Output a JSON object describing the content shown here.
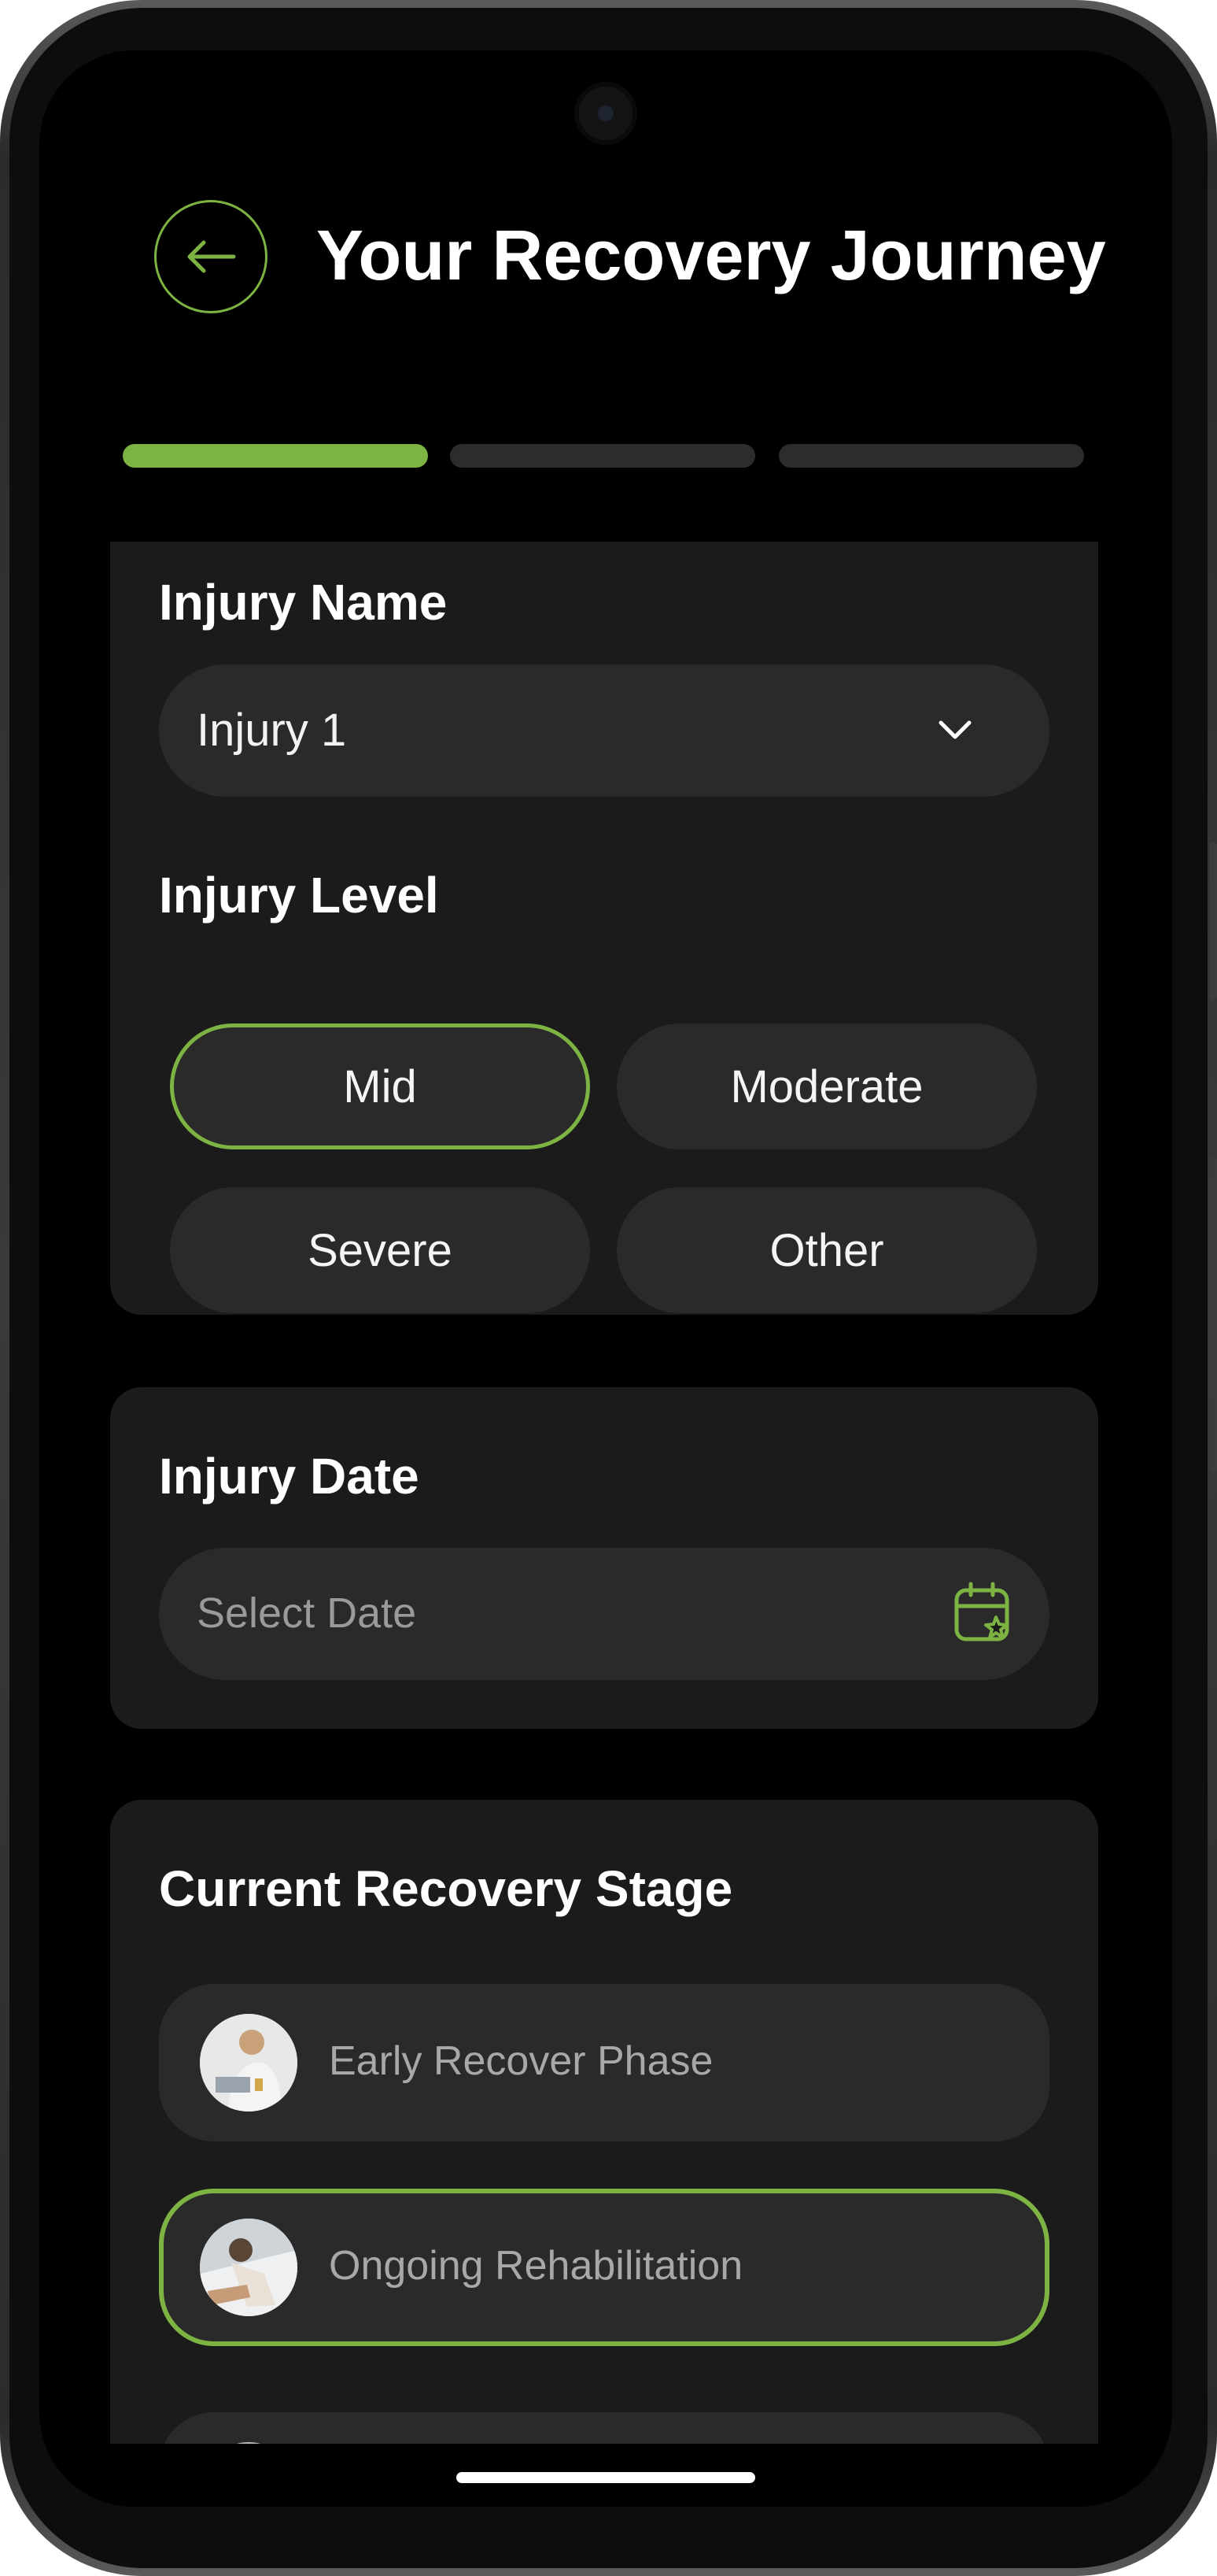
{
  "header": {
    "title": "Your Recovery Journey",
    "back_icon": "arrow-left-icon"
  },
  "progress": {
    "current_step": 1,
    "total_steps": 3,
    "active_color": "#7cb342",
    "inactive_color": "#2c2c2c"
  },
  "injury_name": {
    "label": "Injury Name",
    "value": "Injury 1",
    "icon": "chevron-down-icon"
  },
  "injury_level": {
    "label": "Injury Level",
    "options": [
      "Mid",
      "Moderate",
      "Severe",
      "Other"
    ],
    "selected": "Mid"
  },
  "injury_date": {
    "label": "Injury Date",
    "placeholder": "Select Date",
    "icon": "calendar-icon"
  },
  "recovery_stage": {
    "label": "Current Recovery Stage",
    "stages": [
      "Early Recover Phase",
      "Ongoing Rehabilitation"
    ],
    "selected": "Ongoing Rehabilitation"
  },
  "colors": {
    "accent": "#7cb342",
    "background": "#000000",
    "card": "#1b1b1b",
    "field": "#2a2a2a"
  }
}
